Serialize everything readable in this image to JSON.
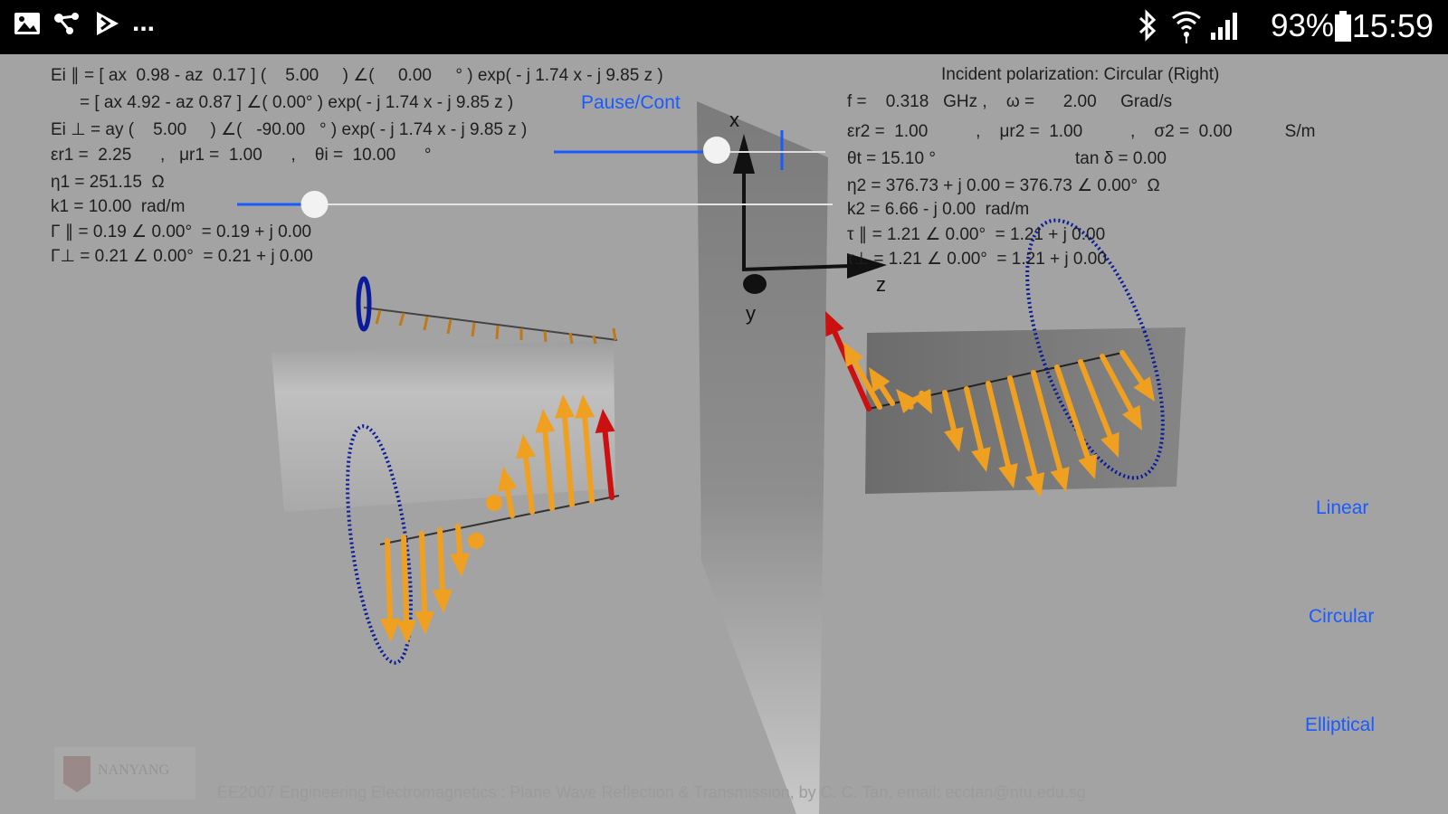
{
  "status_bar": {
    "battery": "93%",
    "time": "15:59",
    "more": "..."
  },
  "left_panel": {
    "ei_par_1": "Ei ∥ = [ ax  0.98 - az  0.17 ] (    5.00     ) ∠(     0.00     ° ) exp( - j 1.74 x - j 9.85 z )",
    "ei_par_2": "= [ ax 4.92 - az 0.87 ] ∠( 0.00° ) exp( - j 1.74 x - j 9.85 z )",
    "ei_perp": "Ei ⊥ = ay (    5.00     ) ∠(   -90.00   ° ) exp( - j 1.74 x - j 9.85 z )",
    "eps_mu_theta": "εr1 =  2.25      ,   μr1 =  1.00      ,    θi =  10.00      °",
    "eta1": "η1 = 251.15  Ω",
    "k1": "k1 = 10.00  rad/m",
    "gamma_par": "Γ ∥ = 0.19 ∠ 0.00°  = 0.19 + j 0.00",
    "gamma_perp": "Γ⊥ = 0.21 ∠ 0.00°  = 0.21 + j 0.00"
  },
  "right_panel": {
    "polarization": "Incident polarization: Circular (Right)",
    "freq": "f =    0.318   GHz ,    ω =      2.00     Grad/s",
    "eps_mu_sigma": "εr2 =  1.00          ,    μr2 =  1.00          ,    σ2 =  0.00           S/m",
    "theta_t": "θt = 15.10 °",
    "tan_delta": "tan δ = 0.00",
    "eta2": "η2 = 376.73 + j 0.00 = 376.73 ∠ 0.00°  Ω",
    "k2": "k2 = 6.66 - j 0.00  rad/m",
    "tau_par": "τ ∥ = 1.21 ∠ 0.00°  = 1.21 + j 0.00",
    "tau_perp": "τ⊥ = 1.21 ∠ 0.00°  = 1.21 + j 0.00"
  },
  "controls": {
    "pause": "Pause/Cont",
    "linear": "Linear",
    "circular": "Circular",
    "elliptical": "Elliptical",
    "slider_time_level": 0.6,
    "slider_k_level": 0.13
  },
  "axes": {
    "x": "x",
    "y": "y",
    "z": "z"
  },
  "footer": {
    "logo": "NANYANG",
    "caption": "EE2007 Engineering Electromagnetics : Plane Wave Reflection & Transmission, by C. C. Tan, email: ecctan@ntu.edu.sg"
  },
  "colors": {
    "arrow": "#f0a020",
    "ellipse": "#0a1a9a",
    "accent": "#1a5bff",
    "highlight": "#cc1010"
  }
}
